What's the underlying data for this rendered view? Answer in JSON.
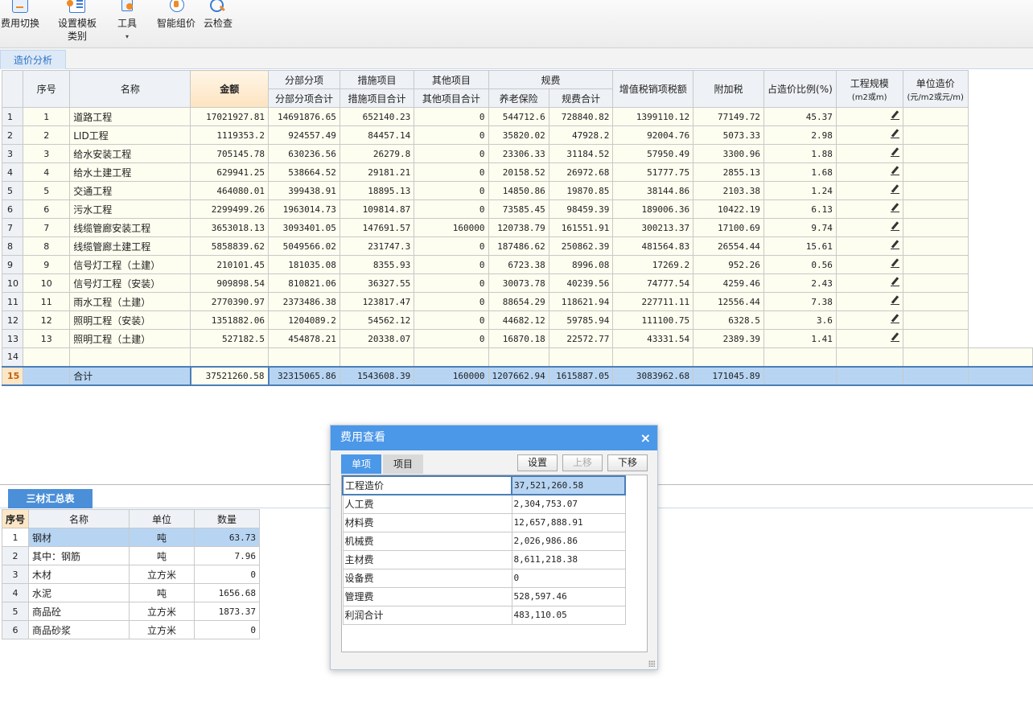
{
  "toolbar": {
    "fee_switch": "费用切换",
    "template_line1": "设置模板",
    "template_line2": "类别",
    "tools": "工具",
    "tools_caret": "▾",
    "smart_price": "智能组价",
    "cloud_check": "云检查"
  },
  "tabs": {
    "cost_analysis": "造价分析"
  },
  "grid": {
    "headers": {
      "seq": "序号",
      "name": "名称",
      "amount": "金额",
      "sub_item": "分部分项",
      "sub_item_total": "分部分项合计",
      "measures": "措施项目",
      "measures_total": "措施项目合计",
      "other": "其他项目",
      "other_total": "其他项目合计",
      "fees": "规费",
      "pension": "养老保险",
      "fees_total": "规费合计",
      "vat": "增值税销项税额",
      "surtax": "附加税",
      "ratio": "占造价比例(%)",
      "scale_line1": "工程规模",
      "scale_line2": "(m2或m)",
      "unit_cost_line1": "单位造价",
      "unit_cost_line2": "(元/m2或元/m)"
    },
    "rows": [
      {
        "rn": "1",
        "seq": "1",
        "name": "道路工程",
        "amount": "17021927.81",
        "sub": "14691876.65",
        "mea": "652140.23",
        "oth": "0",
        "pen": "544712.6",
        "fee": "728840.82",
        "vat": "1399110.12",
        "sur": "77149.72",
        "ratio": "45.37"
      },
      {
        "rn": "2",
        "seq": "2",
        "name": "LID工程",
        "amount": "1119353.2",
        "sub": "924557.49",
        "mea": "84457.14",
        "oth": "0",
        "pen": "35820.02",
        "fee": "47928.2",
        "vat": "92004.76",
        "sur": "5073.33",
        "ratio": "2.98"
      },
      {
        "rn": "3",
        "seq": "3",
        "name": "给水安装工程",
        "amount": "705145.78",
        "sub": "630236.56",
        "mea": "26279.8",
        "oth": "0",
        "pen": "23306.33",
        "fee": "31184.52",
        "vat": "57950.49",
        "sur": "3300.96",
        "ratio": "1.88"
      },
      {
        "rn": "4",
        "seq": "4",
        "name": "给水土建工程",
        "amount": "629941.25",
        "sub": "538664.52",
        "mea": "29181.21",
        "oth": "0",
        "pen": "20158.52",
        "fee": "26972.68",
        "vat": "51777.75",
        "sur": "2855.13",
        "ratio": "1.68"
      },
      {
        "rn": "5",
        "seq": "5",
        "name": "交通工程",
        "amount": "464080.01",
        "sub": "399438.91",
        "mea": "18895.13",
        "oth": "0",
        "pen": "14850.86",
        "fee": "19870.85",
        "vat": "38144.86",
        "sur": "2103.38",
        "ratio": "1.24"
      },
      {
        "rn": "6",
        "seq": "6",
        "name": "污水工程",
        "amount": "2299499.26",
        "sub": "1963014.73",
        "mea": "109814.87",
        "oth": "0",
        "pen": "73585.45",
        "fee": "98459.39",
        "vat": "189006.36",
        "sur": "10422.19",
        "ratio": "6.13"
      },
      {
        "rn": "7",
        "seq": "7",
        "name": "线缆管廊安装工程",
        "amount": "3653018.13",
        "sub": "3093401.05",
        "mea": "147691.57",
        "oth": "160000",
        "pen": "120738.79",
        "fee": "161551.91",
        "vat": "300213.37",
        "sur": "17100.69",
        "ratio": "9.74"
      },
      {
        "rn": "8",
        "seq": "8",
        "name": "线缆管廊土建工程",
        "amount": "5858839.62",
        "sub": "5049566.02",
        "mea": "231747.3",
        "oth": "0",
        "pen": "187486.62",
        "fee": "250862.39",
        "vat": "481564.83",
        "sur": "26554.44",
        "ratio": "15.61"
      },
      {
        "rn": "9",
        "seq": "9",
        "name": "信号灯工程（土建）",
        "amount": "210101.45",
        "sub": "181035.08",
        "mea": "8355.93",
        "oth": "0",
        "pen": "6723.38",
        "fee": "8996.08",
        "vat": "17269.2",
        "sur": "952.26",
        "ratio": "0.56"
      },
      {
        "rn": "10",
        "seq": "10",
        "name": "信号灯工程（安装）",
        "amount": "909898.54",
        "sub": "810821.06",
        "mea": "36327.55",
        "oth": "0",
        "pen": "30073.78",
        "fee": "40239.56",
        "vat": "74777.54",
        "sur": "4259.46",
        "ratio": "2.43"
      },
      {
        "rn": "11",
        "seq": "11",
        "name": "雨水工程（土建）",
        "amount": "2770390.97",
        "sub": "2373486.38",
        "mea": "123817.47",
        "oth": "0",
        "pen": "88654.29",
        "fee": "118621.94",
        "vat": "227711.11",
        "sur": "12556.44",
        "ratio": "7.38"
      },
      {
        "rn": "12",
        "seq": "12",
        "name": "照明工程（安装）",
        "amount": "1351882.06",
        "sub": "1204089.2",
        "mea": "54562.12",
        "oth": "0",
        "pen": "44682.12",
        "fee": "59785.94",
        "vat": "111100.75",
        "sur": "6328.5",
        "ratio": "3.6"
      },
      {
        "rn": "13",
        "seq": "13",
        "name": "照明工程（土建）",
        "amount": "527182.5",
        "sub": "454878.21",
        "mea": "20338.07",
        "oth": "0",
        "pen": "16870.18",
        "fee": "22572.77",
        "vat": "43331.54",
        "sur": "2389.39",
        "ratio": "1.41"
      }
    ],
    "empty_row_num": "14",
    "total": {
      "rn": "15",
      "name": "合计",
      "amount": "37521260.58",
      "sub": "32315065.86",
      "mea": "1543608.39",
      "oth": "160000",
      "pen": "1207662.94",
      "fee": "1615887.05",
      "vat": "3083962.68",
      "sur": "171045.89"
    }
  },
  "materials": {
    "tab": "三材汇总表",
    "headers": {
      "seq": "序号",
      "name": "名称",
      "unit": "单位",
      "qty": "数量"
    },
    "rows": [
      {
        "seq": "1",
        "name": "钢材",
        "unit": "吨",
        "qty": "63.73"
      },
      {
        "seq": "2",
        "name": "其中：钢筋",
        "unit": "吨",
        "qty": "7.96"
      },
      {
        "seq": "3",
        "name": "木材",
        "unit": "立方米",
        "qty": "0"
      },
      {
        "seq": "4",
        "name": "水泥",
        "unit": "吨",
        "qty": "1656.68"
      },
      {
        "seq": "5",
        "name": "商品砼",
        "unit": "立方米",
        "qty": "1873.37"
      },
      {
        "seq": "6",
        "name": "商品砂浆",
        "unit": "立方米",
        "qty": "0"
      }
    ]
  },
  "dialog": {
    "title": "费用查看",
    "close": "×",
    "tab_single": "单项",
    "tab_project": "项目",
    "btn_settings": "设置",
    "btn_up": "上移",
    "btn_down": "下移",
    "rows": [
      {
        "k": "工程造价",
        "v": "37,521,260.58"
      },
      {
        "k": "人工费",
        "v": "2,304,753.07"
      },
      {
        "k": "材料费",
        "v": "12,657,888.91"
      },
      {
        "k": "机械费",
        "v": "2,026,986.86"
      },
      {
        "k": "主材费",
        "v": "8,611,218.38"
      },
      {
        "k": "设备费",
        "v": "0"
      },
      {
        "k": "管理费",
        "v": "528,597.46"
      },
      {
        "k": "利润合计",
        "v": "483,110.05"
      }
    ]
  }
}
